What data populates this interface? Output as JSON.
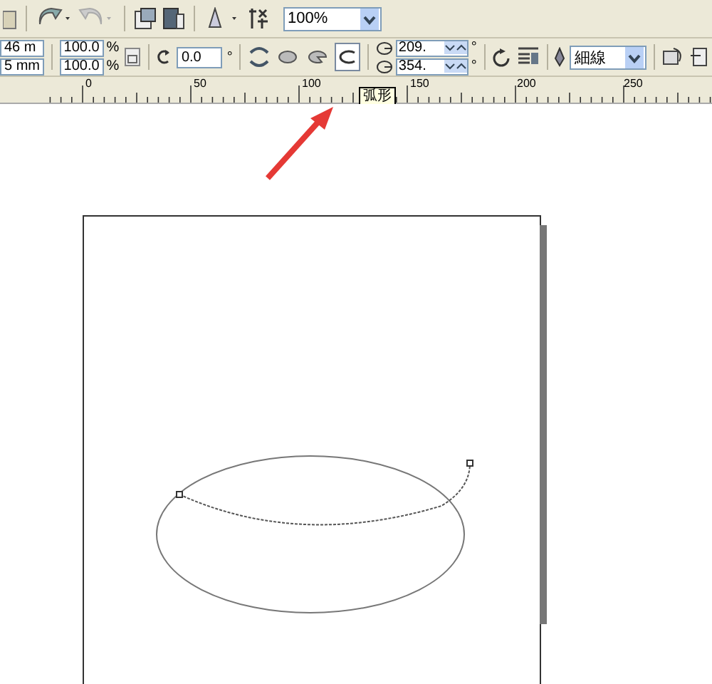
{
  "standard_toolbar": {
    "zoom": "100%"
  },
  "property_bar": {
    "size": [
      "46 m",
      "5 mm"
    ],
    "scale": [
      {
        "value": "100.0",
        "unit": "%"
      },
      {
        "value": "100.0",
        "unit": "%"
      }
    ],
    "rotation": {
      "value": "0.0",
      "unit": "°"
    },
    "shape_modes": [
      {
        "kind": "ellipse",
        "selected": false
      },
      {
        "kind": "pie",
        "selected": false
      },
      {
        "kind": "arc",
        "selected": true
      }
    ],
    "angles": [
      {
        "value": "209.",
        "unit": "°"
      },
      {
        "value": "354.",
        "unit": "°"
      }
    ],
    "outline": "細線"
  },
  "ruler": {
    "labels": [
      "0",
      "50",
      "100",
      "150",
      "200",
      "250"
    ]
  },
  "tooltip": "弧形"
}
